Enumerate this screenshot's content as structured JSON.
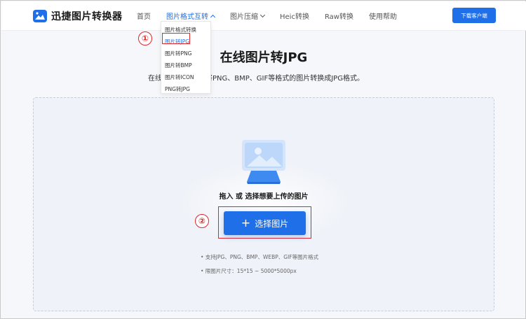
{
  "header": {
    "logo_text": "迅捷图片转换器",
    "nav": [
      {
        "label": "首页",
        "active": false,
        "chevron": ""
      },
      {
        "label": "图片格式互转",
        "active": true,
        "chevron": "up"
      },
      {
        "label": "图片压缩",
        "active": false,
        "chevron": "down"
      },
      {
        "label": "Heic转换",
        "active": false,
        "chevron": ""
      },
      {
        "label": "Raw转换",
        "active": false,
        "chevron": ""
      },
      {
        "label": "使用帮助",
        "active": false,
        "chevron": ""
      }
    ],
    "download_label": "下载客户端"
  },
  "dropdown": {
    "items": [
      "图片格式转换",
      "图片转JPG",
      "图片转PNG",
      "图片转BMP",
      "图片转ICON",
      "PNG转JPG"
    ],
    "selected_index": 1
  },
  "annotations": {
    "step1": "①",
    "step2": "②"
  },
  "main": {
    "title": "在线图片转JPG",
    "subtitle_start": "在线",
    "subtitle_rest": "，可将PNG、BMP、GIF等格式的图片转换成JPG格式。"
  },
  "upload": {
    "drop_text": "拖入 或 选择想要上传的图片",
    "select_label": "选择图片",
    "support_text": "• 支持JPG、PNG、BMP、WEBP、GIF等图片格式",
    "limit_text": "• 限图片尺寸：15*15 ~ 5000*5000px"
  },
  "colors": {
    "accent": "#1f6fe8",
    "annotation": "#e0262b"
  }
}
